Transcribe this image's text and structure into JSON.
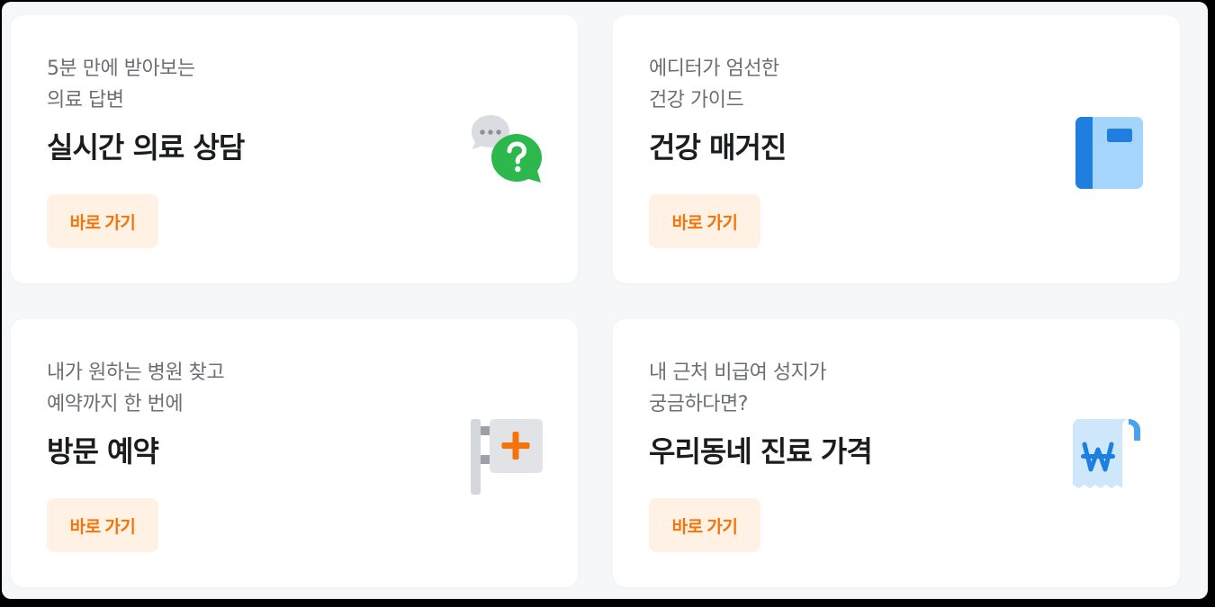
{
  "cards": [
    {
      "subtitle_lines": [
        "5분 만에 받아보는",
        "의료 답변"
      ],
      "title": "실시간 의료 상담",
      "button_label": "바로 가기",
      "icon": "chat-question-icon"
    },
    {
      "subtitle_lines": [
        "에디터가 엄선한",
        "건강 가이드"
      ],
      "title": "건강 매거진",
      "button_label": "바로 가기",
      "icon": "book-icon"
    },
    {
      "subtitle_lines": [
        "내가 원하는 병원 찾고",
        "예약까지 한 번에"
      ],
      "title": "방문 예약",
      "button_label": "바로 가기",
      "icon": "hospital-sign-icon"
    },
    {
      "subtitle_lines": [
        "내 근처 비급여 성지가",
        "궁금하다면?"
      ],
      "title": "우리동네 진료 가격",
      "button_label": "바로 가기",
      "icon": "won-receipt-icon"
    }
  ],
  "colors": {
    "accent": "#f4740a",
    "button_bg": "#fff2e5",
    "chat_green": "#2db84d",
    "book_blue": "#1e7fde",
    "receipt_blue": "#4aa3ea"
  }
}
